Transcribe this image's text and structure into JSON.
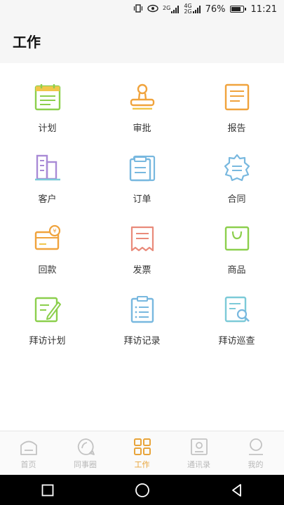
{
  "status_bar": {
    "signal_label_1": "2G",
    "signal_label_2": "4G",
    "signal_label_3": "2G",
    "battery_text": "76%",
    "time": "11:21"
  },
  "header": {
    "title": "工作"
  },
  "grid": {
    "items": [
      {
        "label": "计划",
        "icon": "plan-icon"
      },
      {
        "label": "审批",
        "icon": "stamp-icon"
      },
      {
        "label": "报告",
        "icon": "report-icon"
      },
      {
        "label": "客户",
        "icon": "building-icon"
      },
      {
        "label": "订单",
        "icon": "order-icon"
      },
      {
        "label": "合同",
        "icon": "contract-icon"
      },
      {
        "label": "回款",
        "icon": "payment-icon"
      },
      {
        "label": "发票",
        "icon": "invoice-icon"
      },
      {
        "label": "商品",
        "icon": "product-icon"
      },
      {
        "label": "拜访计划",
        "icon": "visit-plan-icon"
      },
      {
        "label": "拜访记录",
        "icon": "visit-record-icon"
      },
      {
        "label": "拜访巡查",
        "icon": "visit-inspect-icon"
      }
    ]
  },
  "tabbar": {
    "tabs": [
      {
        "label": "首页",
        "icon": "home-icon",
        "active": false
      },
      {
        "label": "同事圈",
        "icon": "chat-icon",
        "active": false
      },
      {
        "label": "工作",
        "icon": "grid-icon",
        "active": true
      },
      {
        "label": "通讯录",
        "icon": "contacts-icon",
        "active": false
      },
      {
        "label": "我的",
        "icon": "profile-icon",
        "active": false
      }
    ]
  },
  "colors": {
    "active_tab": "#e8a43a",
    "inactive_tab": "#b9b9b9",
    "green": "#8ccf4d",
    "orange": "#f0a33c",
    "purple": "#a98ad6",
    "blue": "#78b8df"
  }
}
